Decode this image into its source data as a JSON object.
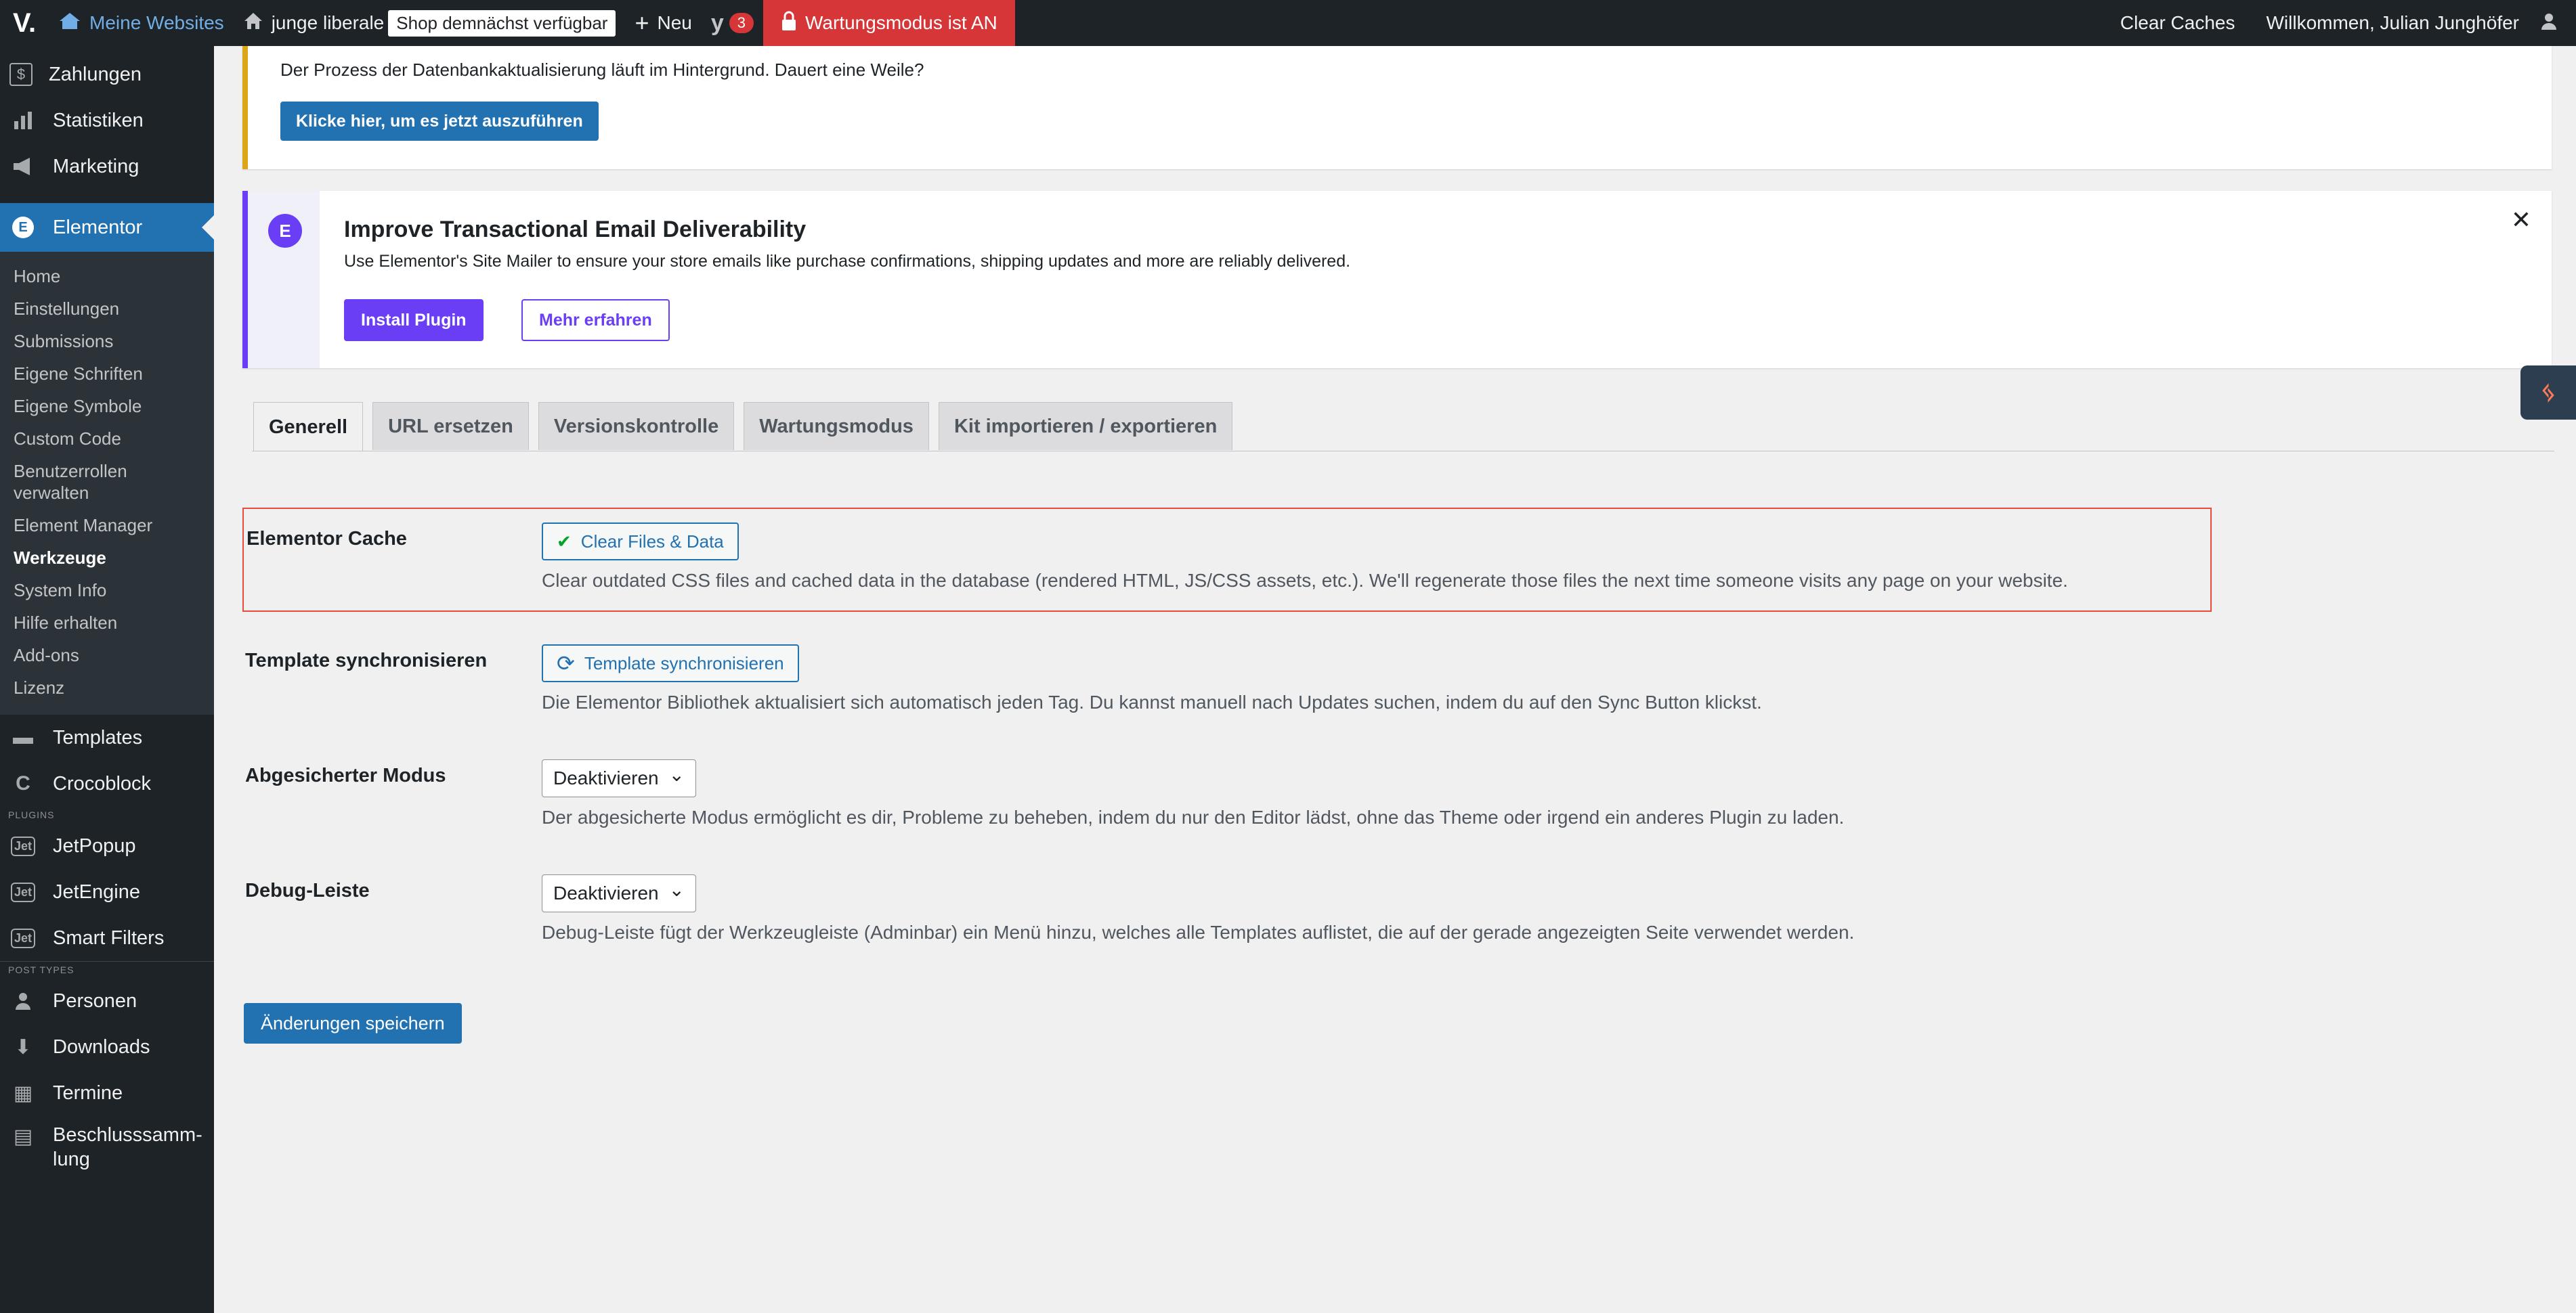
{
  "adminbar": {
    "logo": "V.",
    "my_sites": "Meine Websites",
    "site_name": "junge liberale",
    "shop_badge": "Shop demnächst verfügbar",
    "new": "Neu",
    "yoast_logo": "y",
    "yoast_count": "3",
    "maintenance": "Wartungsmodus ist AN",
    "clear_caches": "Clear Caches",
    "welcome": "Willkommen, Julian Junghöfer"
  },
  "sidebar": {
    "top_items": [
      {
        "label": "Zahlungen",
        "icon": "payments-icon",
        "glyph": "$"
      },
      {
        "label": "Statistiken",
        "icon": "stats-icon",
        "glyph": "▮"
      },
      {
        "label": "Marketing",
        "icon": "megaphone-icon",
        "glyph": "📣"
      }
    ],
    "elementor": {
      "label": "Elementor",
      "glyph": "E"
    },
    "elementor_sub": [
      "Home",
      "Einstellungen",
      "Submissions",
      "Eigene Schriften",
      "Eigene Symbole",
      "Custom Code",
      "Benutzerrollen verwalten",
      "Element Manager",
      "Werkzeuge",
      "System Info",
      "Hilfe erhalten",
      "Add-ons",
      "Lizenz"
    ],
    "templates": "Templates",
    "templates_glyph": "▬",
    "crocoblock": "Crocoblock",
    "crocoblock_glyph": "C",
    "plugins_sep": "PLUGINS",
    "jet_glyph": "Jet",
    "jet_items": [
      "JetPopup",
      "JetEngine",
      "Smart Filters"
    ],
    "posttypes_sep": "POST TYPES",
    "person": "Personen",
    "person_glyph": "👤",
    "downloads": "Downloads",
    "downloads_glyph": "⬇",
    "termine": "Termine",
    "termine_glyph": "▦",
    "beschluss": "Beschlusssamm-lung",
    "beschluss_glyph": "▤"
  },
  "notice_db": {
    "text": "Der Prozess der Datenbankaktualisierung läuft im Hintergrund. Dauert eine Weile?",
    "button": "Klicke hier, um es jetzt auszuführen"
  },
  "notice_mail": {
    "logo": "E",
    "title": "Improve Transactional Email Deliverability",
    "desc": "Use Elementor's Site Mailer to ensure your store emails like purchase confirmations, shipping updates and more are reliably delivered.",
    "install": "Install Plugin",
    "more": "Mehr erfahren",
    "close": "✕"
  },
  "tabs": [
    "Generell",
    "URL ersetzen",
    "Versionskontrolle",
    "Wartungsmodus",
    "Kit importieren / exportieren"
  ],
  "hubspot_glyph": "ᛃ",
  "settings": {
    "cache": {
      "label": "Elementor Cache",
      "button_icon": "✔",
      "button": "Clear Files & Data",
      "desc": "Clear outdated CSS files and cached data in the database (rendered HTML, JS/CSS assets, etc.). We'll regenerate those files the next time someone visits any page on your website."
    },
    "sync": {
      "label": "Template synchronisieren",
      "button_icon": "⟳",
      "button": "Template synchronisieren",
      "desc": "Die Elementor Bibliothek aktualisiert sich automatisch jeden Tag. Du kannst manuell nach Updates suchen, indem du auf den Sync Button klickst."
    },
    "safe": {
      "label": "Abgesicherter Modus",
      "value": "Deaktivieren",
      "desc": "Der abgesicherte Modus ermöglicht es dir, Probleme zu beheben, indem du nur den Editor lädst, ohne das Theme oder irgend ein anderes Plugin zu laden."
    },
    "debug": {
      "label": "Debug-Leiste",
      "value": "Deaktivieren",
      "desc": "Debug-Leiste fügt der Werkzeugleiste (Adminbar) ein Menü hinzu, welches alle Templates auflistet, die auf der gerade angezeigten Seite verwendet werden."
    },
    "chevron": "⌄"
  },
  "save": "Änderungen speichern",
  "colors": {
    "wp_blue": "#2271b1",
    "elementor_purple": "#6a3ef5",
    "warning": "#dba617",
    "danger": "#d63638"
  }
}
